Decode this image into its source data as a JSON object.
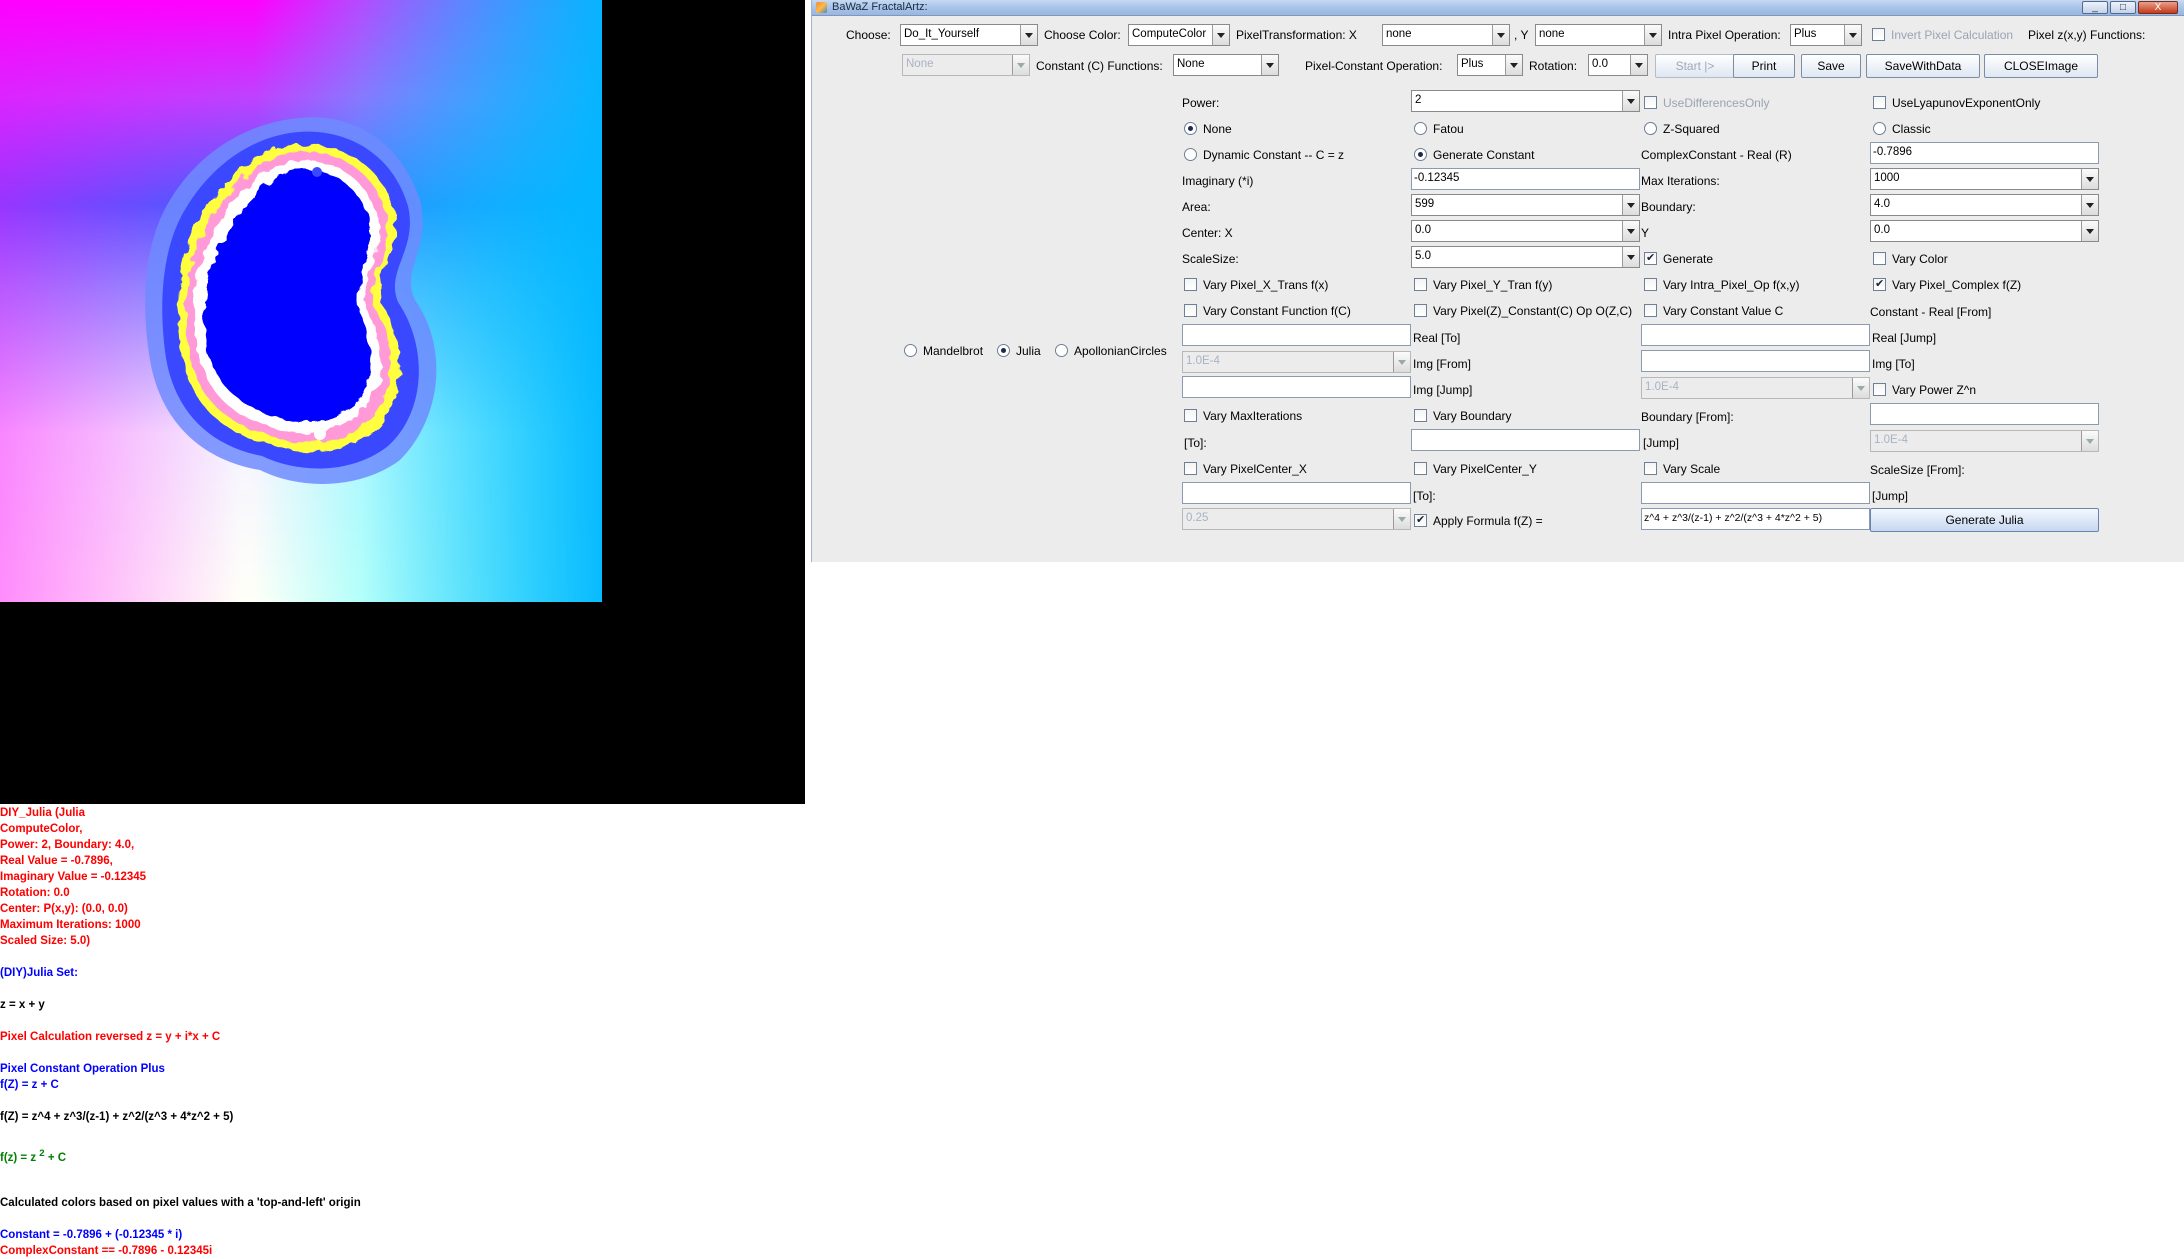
{
  "window": {
    "title": "BaWaZ FractalArtz:",
    "min": "_",
    "max": "□",
    "close": "X"
  },
  "toolbar": {
    "choose_label": "Choose:",
    "choose_value": "Do_It_Yourself",
    "choose_color_label": "Choose Color:",
    "choose_color_value": "ComputeColor",
    "pixel_transformation_label": "PixelTransformation:  X",
    "pixel_x_value": "none",
    "comma_y_label": ",  Y",
    "pixel_y_value": "none",
    "intra_pixel_label": "Intra Pixel Operation:",
    "intra_pixel_value": "Plus",
    "invert_pixel_label": "Invert Pixel Calculation",
    "pixel_functions_label": "Pixel z(x,y) Functions:",
    "pixel_function_value": "None",
    "constant_functions_label": "Constant (C) Functions:",
    "constant_functions_value": "None",
    "pixel_constant_label": "Pixel-Constant Operation:",
    "pixel_constant_value": "Plus",
    "rotation_label": "Rotation:",
    "rotation_value": "0.0",
    "start_button": "Start |>",
    "print_button": "Print",
    "save_button": "Save",
    "save_with_data_button": "SaveWithData",
    "close_image_button": "CLOSEImage"
  },
  "fractal_type": {
    "mandelbrot": "Mandelbrot",
    "julia": "Julia",
    "apollonian": "ApollonianCircles",
    "selected": "julia"
  },
  "form": {
    "power_label": "Power:",
    "power_value": "2",
    "use_differences_only": "UseDifferencesOnly",
    "use_lyapunov_only": "UseLyapunovExponentOnly",
    "radio_none": "None",
    "radio_fatou": "Fatou",
    "radio_zsquared": "Z-Squared",
    "radio_classic": "Classic",
    "radio_dynamic_constant": "Dynamic Constant -- C = z",
    "radio_generate_constant": "Generate Constant",
    "complex_real_label": "ComplexConstant - Real (R)",
    "complex_real_value": "-0.7896",
    "imaginary_label": "Imaginary (*i)",
    "imaginary_value": "-0.12345",
    "max_iterations_label": "Max Iterations:",
    "max_iterations_value": "1000",
    "area_label": "Area:",
    "area_value": "599",
    "boundary_label": "Boundary:",
    "boundary_value": "4.0",
    "center_x_label": "Center: X",
    "center_x_value": "0.0",
    "y_label": "Y",
    "center_y_value": "0.0",
    "scale_size_label": "ScaleSize:",
    "scale_size_value": "5.0",
    "generate_label": "Generate",
    "vary_color_label": "Vary Color",
    "vary_pixel_x_trans": "Vary Pixel_X_Trans f(x)",
    "vary_pixel_y_tran": "Vary Pixel_Y_Tran f(y)",
    "vary_intra_pixel_op": "Vary Intra_Pixel_Op f(x,y)",
    "vary_pixel_complex": "Vary Pixel_Complex f(Z)",
    "vary_constant_function": "Vary Constant Function f(C)",
    "vary_pixel_constant": "Vary Pixel(Z)_Constant(C) Op O(Z,C)",
    "vary_constant_value": "Vary Constant Value  C",
    "constant_real_from": "Constant - Real [From]",
    "real_to": "Real [To]",
    "real_jump": "Real [Jump]",
    "img_from": "Img [From]",
    "img_to": "Img [To]",
    "img_jump": "Img [Jump]",
    "real_jump_combo": "1.0E-4",
    "img_jump_combo": "1.0E-4",
    "vary_power": "Vary Power Z^n",
    "vary_max_iterations": "Vary MaxIterations",
    "vary_boundary": "Vary Boundary",
    "boundary_from": "Boundary [From]:",
    "to_label": "[To]:",
    "jump_label": "[Jump]",
    "boundary_jump_combo": "1.0E-4",
    "vary_pixel_center_x": "Vary PixelCenter_X",
    "vary_pixel_center_y": "Vary PixelCenter_Y",
    "vary_scale": "Vary Scale",
    "scale_size_from": "ScaleSize [From]:",
    "to_label_2": "[To]:",
    "jump_label_2": "[Jump]",
    "center_jump_combo": "0.25",
    "apply_formula_label": "Apply Formula f(Z) =",
    "formula_value": "z^4 + z^3/(z-1) + z^2/(z^3 + 4*z^2 + 5)",
    "generate_julia_button": "Generate Julia"
  },
  "info": {
    "l1": "DIY_Julia (Julia",
    "l2": "ComputeColor,",
    "l3": "Power: 2, Boundary: 4.0,",
    "l4": "Real Value = -0.7896,",
    "l5": "Imaginary Value = -0.12345",
    "l6": "Rotation: 0.0",
    "l7": "Center: P(x,y): (0.0, 0.0)",
    "l8": "Maximum Iterations: 1000",
    "l9": "Scaled Size: 5.0)",
    "set_title": "(DIY)Julia Set:",
    "z_def": "z = x + y",
    "pixel_calc": "Pixel Calculation reversed z = y + i*x + C",
    "pixel_const_op": "Pixel Constant Operation Plus",
    "fz_plus": "f(Z) = z + C",
    "fz_formula": "f(Z) = z^4 + z^3/(z-1) + z^2/(z^3 + 4*z^2 + 5)",
    "fz_power_pre": "f(z) = z ",
    "fz_power_exp": "2",
    "fz_power_post": " + C",
    "colors_note": "Calculated colors based on pixel values with a 'top-and-left' origin",
    "constant_line": "Constant = -0.7896 + (-0.12345 * i)",
    "complex_constant_line": "ComplexConstant == -0.7896 - 0.12345i"
  },
  "colors": {
    "fractal_interior": "#0000ff",
    "info_red": "#ff0000",
    "info_blue": "#0000ff",
    "info_green": "#008000"
  }
}
